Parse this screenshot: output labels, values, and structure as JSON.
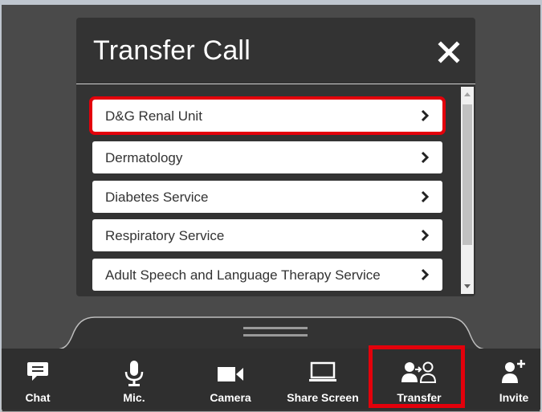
{
  "dialog": {
    "title": "Transfer Call",
    "close_icon": "close-icon",
    "items": [
      {
        "label": "D&G Renal Unit",
        "highlighted": true
      },
      {
        "label": "Dermatology"
      },
      {
        "label": "Diabetes Service"
      },
      {
        "label": "Respiratory Service"
      },
      {
        "label": "Adult Speech and Language Therapy Service"
      }
    ]
  },
  "toolbar": {
    "buttons": [
      {
        "label": "Chat",
        "icon": "chat-icon"
      },
      {
        "label": "Mic.",
        "icon": "microphone-icon"
      },
      {
        "label": "Camera",
        "icon": "camera-icon"
      },
      {
        "label": "Share Screen",
        "icon": "share-screen-icon"
      },
      {
        "label": "Transfer",
        "icon": "transfer-icon",
        "highlighted": true
      },
      {
        "label": "Invite",
        "icon": "invite-icon"
      }
    ]
  },
  "colors": {
    "highlight": "#e3000b",
    "background": "#4a4a4a",
    "dialog": "#333333",
    "toolbar": "#2f2f2f"
  }
}
